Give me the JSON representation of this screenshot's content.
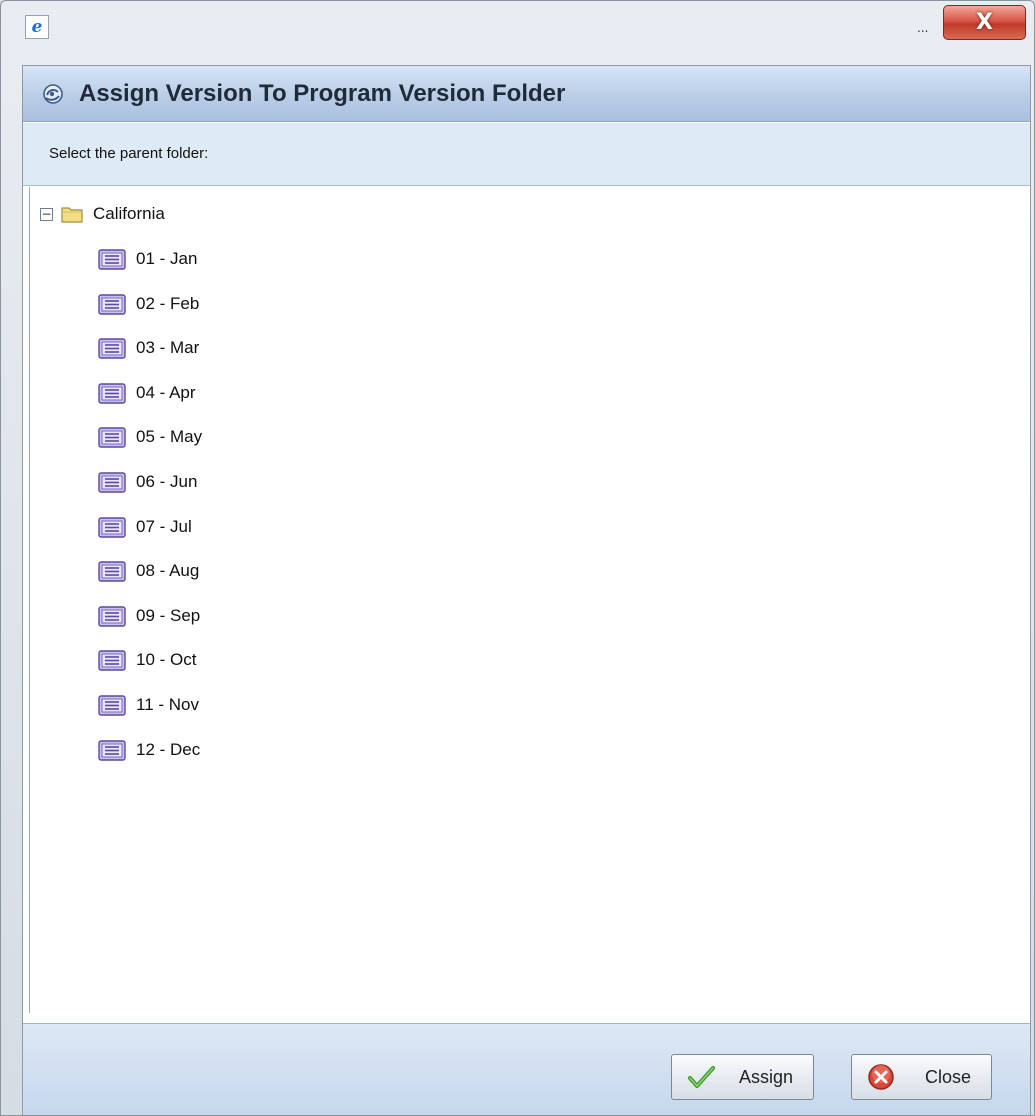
{
  "window": {
    "ellipsis": "...",
    "close_glyph": "X"
  },
  "dialog": {
    "title": "Assign Version To Program Version Folder",
    "instruction": "Select the parent folder:"
  },
  "tree": {
    "root": {
      "label": "California",
      "expanded": true,
      "expander_glyph": "−"
    },
    "items": [
      {
        "label": "01 - Jan"
      },
      {
        "label": "02 - Feb"
      },
      {
        "label": "03 - Mar"
      },
      {
        "label": "04 - Apr"
      },
      {
        "label": "05 - May"
      },
      {
        "label": "06 - Jun"
      },
      {
        "label": "07 - Jul"
      },
      {
        "label": "08 - Aug"
      },
      {
        "label": "09 - Sep"
      },
      {
        "label": "10 - Oct"
      },
      {
        "label": "11 - Nov"
      },
      {
        "label": "12 - Dec"
      }
    ]
  },
  "buttons": {
    "assign": {
      "label": "Assign",
      "icon": "checkmark-icon"
    },
    "close": {
      "label": "Close",
      "icon": "close-circle-icon"
    }
  },
  "colors": {
    "header_gradient_top": "#d7e5f5",
    "header_gradient_bottom": "#a9c0df",
    "subheader_bg": "#dfeaf7",
    "folder_yellow": "#f2dd86",
    "list_icon_purple": "#8a78c8",
    "close_button_red": "#c0392b"
  }
}
